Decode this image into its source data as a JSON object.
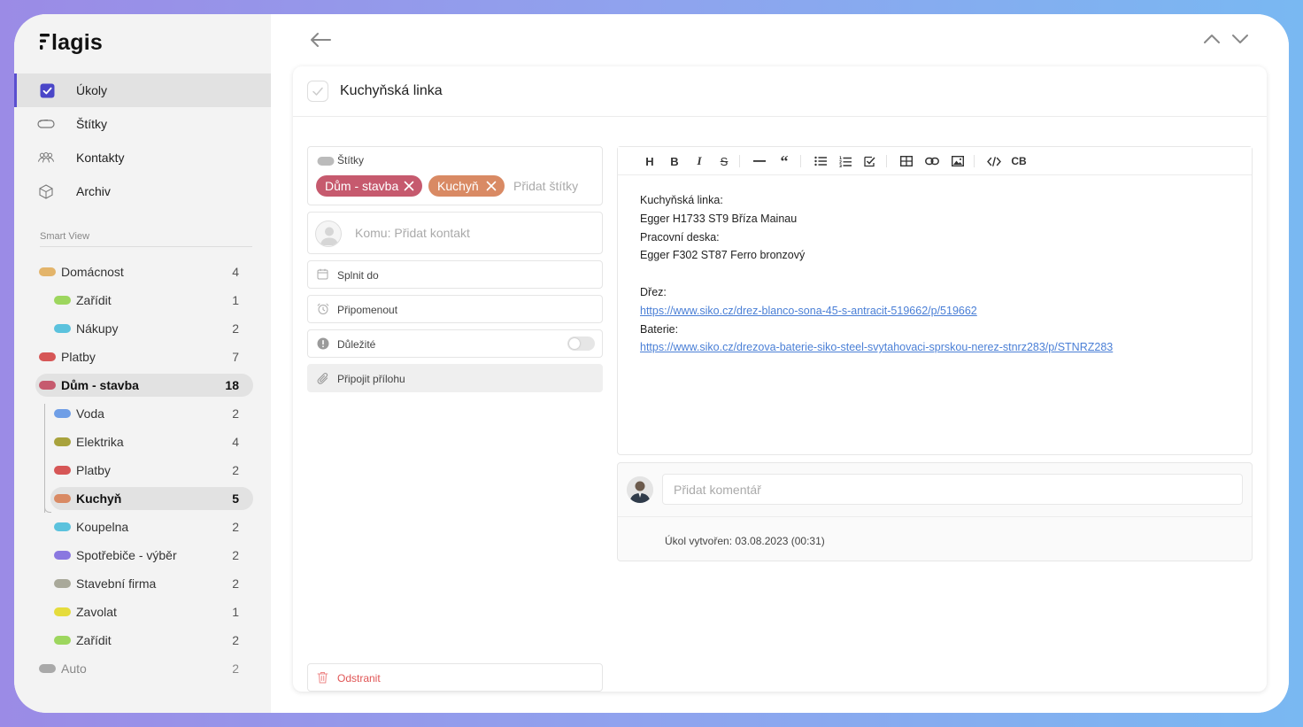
{
  "app": {
    "logo": "lagis",
    "nav": [
      {
        "label": "Úkoly",
        "icon": "checkbox-icon",
        "active": true
      },
      {
        "label": "Štítky",
        "icon": "tag-icon"
      },
      {
        "label": "Kontakty",
        "icon": "contacts-icon"
      },
      {
        "label": "Archiv",
        "icon": "archive-icon"
      }
    ],
    "smart_view_label": "Smart View",
    "tags": [
      {
        "name": "Domácnost",
        "count": "4",
        "color": "#e3b46a",
        "level": 0
      },
      {
        "name": "Zařídit",
        "count": "1",
        "color": "#9dd65e",
        "level": 1
      },
      {
        "name": "Nákupy",
        "count": "2",
        "color": "#5bc2dd",
        "level": 1
      },
      {
        "name": "Platby",
        "count": "7",
        "color": "#d65656",
        "level": 0
      },
      {
        "name": "Dům - stavba",
        "count": "18",
        "color": "#c65a6e",
        "level": 0,
        "selected": true
      },
      {
        "name": "Voda",
        "count": "2",
        "color": "#6f9ee6",
        "level": 1
      },
      {
        "name": "Elektrika",
        "count": "4",
        "color": "#a8a23c",
        "level": 1
      },
      {
        "name": "Platby",
        "count": "2",
        "color": "#d65656",
        "level": 1
      },
      {
        "name": "Kuchyň",
        "count": "5",
        "color": "#d98a64",
        "level": 1,
        "selected": true
      },
      {
        "name": "Koupelna",
        "count": "2",
        "color": "#5bc2dd",
        "level": 1
      },
      {
        "name": "Spotřebiče - výběr",
        "count": "2",
        "color": "#8a78e0",
        "level": 1
      },
      {
        "name": "Stavební firma",
        "count": "2",
        "color": "#a9a99a",
        "level": 1
      },
      {
        "name": "Zavolat",
        "count": "1",
        "color": "#e5dc3c",
        "level": 1
      },
      {
        "name": "Zařídit",
        "count": "2",
        "color": "#9dd65e",
        "level": 1
      },
      {
        "name": "Auto",
        "count": "2",
        "color": "#a9a9a9",
        "level": 0,
        "muted": true
      }
    ]
  },
  "task": {
    "title": "Kuchyňská linka",
    "tags_label": "Štítky",
    "chips": [
      {
        "label": "Dům - stavba",
        "color": "#c65a6e"
      },
      {
        "label": "Kuchyň",
        "color": "#d98a64"
      }
    ],
    "add_tag_placeholder": "Přidat štítky",
    "contact_placeholder": "Komu: Přidat kontakt",
    "due_label": "Splnit do",
    "remind_label": "Připomenout",
    "important_label": "Důležité",
    "attach_label": "Připojit přílohu",
    "delete_label": "Odstranit"
  },
  "editor": {
    "toolbar": [
      "H",
      "B",
      "I",
      "S",
      "—",
      "“",
      "ul",
      "ol",
      "task",
      "table",
      "link",
      "image",
      "code",
      "CB"
    ],
    "lines": [
      "Kuchyňská linka:",
      "Egger H1733 ST9 Bříza Mainau",
      "Pracovní deska:",
      "Egger F302 ST87 Ferro bronzový",
      "",
      "Dřez:",
      "https://www.siko.cz/drez-blanco-sona-45-s-antracit-519662/p/519662",
      "Baterie:",
      "https://www.siko.cz/drezova-baterie-siko-steel-svytahovaci-sprskou-nerez-stnrz283/p/STNRZ283"
    ]
  },
  "comments": {
    "placeholder": "Přidat komentář",
    "created": "Úkol vytvořen: 03.08.2023 (00:31)"
  },
  "colors": {
    "accent": "#5a4fcf",
    "link": "#4a7fd6",
    "danger": "#e05555"
  }
}
